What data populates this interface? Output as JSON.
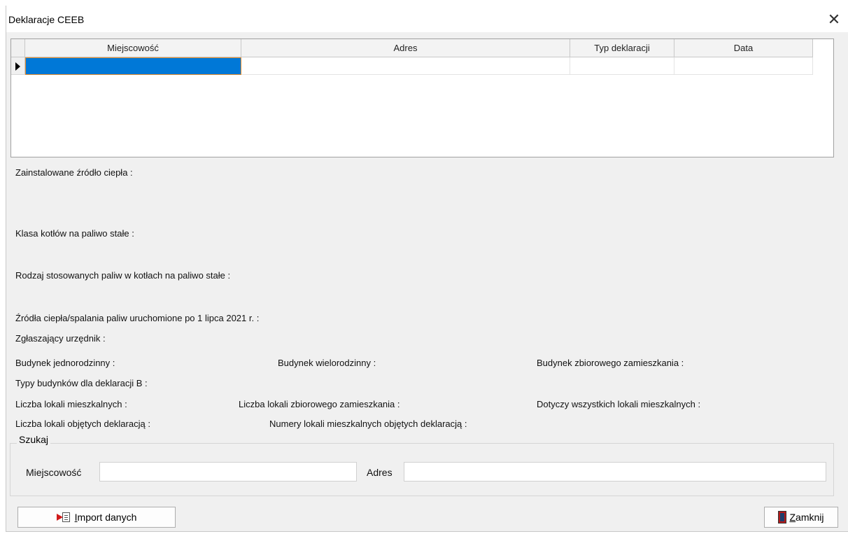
{
  "window": {
    "title": "Deklaracje CEEB"
  },
  "grid": {
    "columns": [
      "Miejscowość",
      "Adres",
      "Typ deklaracji",
      "Data"
    ]
  },
  "details": {
    "zrodlo_ciepla": "Zainstalowane źródło ciepła :",
    "klasa_kotlow": "Klasa kotłów na paliwo stałe :",
    "rodzaj_paliw": "Rodzaj stosowanych paliw w kotłach na paliwo stałe :",
    "zrodla_po_2021": "Źródła ciepła/spalania paliw uruchomione po 1 lipca 2021 r. :",
    "urzednik": "Zgłaszający urzędnik :",
    "budynek_jednorodzinny": "Budynek jednorodzinny :",
    "budynek_wielorodzinny": "Budynek wielorodzinny :",
    "budynek_zbiorowy": "Budynek zbiorowego zamieszkania :",
    "typy_budynkow_b": "Typy budynków dla deklaracji B :",
    "liczba_lokali": "Liczba lokali mieszkalnych :",
    "liczba_lokali_zbiorowych": "Liczba lokali zbiorowego zamieszkania :",
    "dotyczy_wszystkich": "Dotyczy wszystkich lokali mieszkalnych :",
    "liczba_objetych": "Liczba lokali objętych deklaracją :",
    "numery_lokali": "Numery lokali mieszkalnych objętych deklaracją :"
  },
  "search": {
    "title": "Szukaj",
    "miejscowosc_label": "Miejscowość",
    "miejscowosc_value": "",
    "adres_label": "Adres",
    "adres_value": ""
  },
  "buttons": {
    "import_first": "I",
    "import_rest": "mport danych",
    "close_first": "Z",
    "close_rest": "amknij"
  }
}
